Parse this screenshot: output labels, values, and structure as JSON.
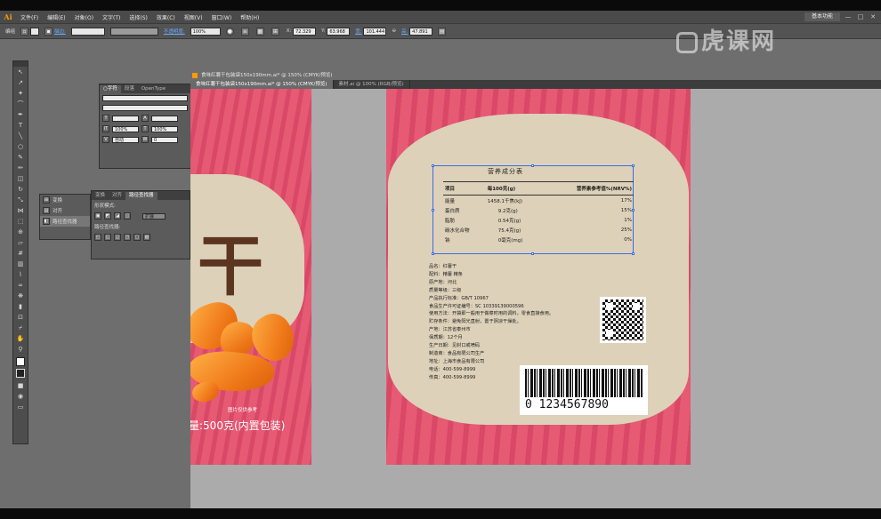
{
  "app": {
    "logo": "Ai"
  },
  "menu": [
    "文件(F)",
    "编辑(E)",
    "对象(O)",
    "文字(T)",
    "选择(S)",
    "效果(C)",
    "视图(V)",
    "窗口(W)",
    "帮助(H)"
  ],
  "workspace": "基本功能",
  "window_controls": [
    "—",
    "□",
    "✕"
  ],
  "control_bar": {
    "selection": "编组",
    "stroke_label": "描边:",
    "opacity_label": "不透明度:",
    "opacity": "100%",
    "x": "72.329",
    "y": "63.968",
    "w_label": "宽:",
    "w": "101.444",
    "h_label": "高:",
    "h": "47.891"
  },
  "watermark": "虎课网",
  "char_panel": {
    "tabs": [
      "○字符",
      "段落",
      "OpenType"
    ],
    "size": "100%",
    "scale": "100%",
    "leading": "自动",
    "tracking": "0",
    "track_label": "0"
  },
  "pathfinder_panel": {
    "side_items": [
      "变换",
      "对齐",
      "路径查找器"
    ],
    "tabs": [
      "变换",
      "对齐",
      "路径查找器"
    ],
    "shape_modes_label": "形状模式:",
    "pathfinders_label": "路径查找器:",
    "expand_label": "扩展"
  },
  "doc_window_title": "食味红薯干包装袋150x190mm.ai* @ 150% (CMYK/预览)",
  "doc_tabs": [
    "食味红薯干包装袋150x190mm.ai* @ 150% (CMYK/预览)",
    "素材.ai @ 100% (RGB/预览)"
  ],
  "left_art": {
    "glyph": "干",
    "note": "图片仅供参考",
    "weight": "量:500克(内置包装)"
  },
  "nutrition": {
    "title": "营养成分表",
    "headers": [
      "项目",
      "每100克(g)",
      "营养素参考值%(NRV%)"
    ],
    "rows": [
      [
        "能量",
        "1458.1千焦(kJ)",
        "17%"
      ],
      [
        "蛋白质",
        "9.2克(g)",
        "15%"
      ],
      [
        "脂肪",
        "0.54克(g)",
        "1%"
      ],
      [
        "碳水化合物",
        "75.4克(g)",
        "25%"
      ],
      [
        "钠",
        "0毫克(mg)",
        "0%"
      ]
    ]
  },
  "product_info": [
    "品名：红薯干",
    "配料：精薯 精条",
    "原产地：河北",
    "质量等级：三级",
    "产品执行标准：GB/T 10967",
    "食品生产许可证编号：SC 10339139000596",
    "使用方法：开袋即一般用于做菜时用的调料，零食直接食用。",
    "贮存条件：避免阳光直射，置于阴凉干燥处。",
    "产地：江苏省泰州市",
    "保质期：12个月",
    "生产日期：见封口或喷码",
    "制造商：食品有限公司生产",
    "地址：上海市食品有限公司",
    "电话：400-599-8999",
    "传真：400-599-8999"
  ],
  "barcode": "0 1234567890"
}
